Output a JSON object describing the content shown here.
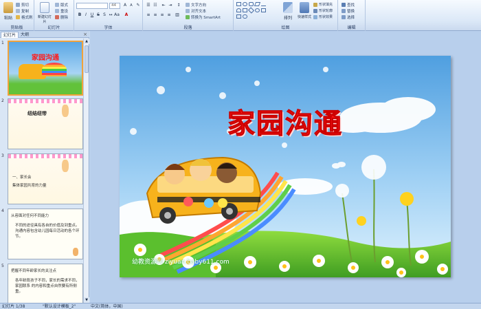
{
  "ribbon": {
    "groups": {
      "clipboard": "剪贴板",
      "slides": "幻灯片",
      "font": "字体",
      "paragraph": "段落",
      "drawing": "绘图",
      "editing": "编辑"
    },
    "paste": "粘贴",
    "cut": "剪切",
    "copy": "复制",
    "format_painter": "格式刷",
    "new_slide": "新建幻灯片",
    "layout": "版式",
    "reset": "重设",
    "delete": "删除",
    "font_size": "44",
    "text_direction": "文字方向",
    "align_text": "对齐文本",
    "smartart": "转换为 SmartArt",
    "arrange": "排列",
    "quick_styles": "快速样式",
    "shape_fill": "形状填充",
    "shape_outline": "形状轮廓",
    "shape_effects": "形状效果",
    "find": "查找",
    "replace": "替换",
    "select": "选择"
  },
  "panel": {
    "tab_slides": "幻灯片",
    "tab_outline": "大纲",
    "close": "×"
  },
  "thumbnails": [
    {
      "num": "1",
      "title": "家园沟通"
    },
    {
      "num": "2",
      "title": "纽结纽带"
    },
    {
      "num": "3",
      "lines": [
        "一、家长会",
        "集体家园共育的力量"
      ]
    },
    {
      "num": "4",
      "lines": [
        "从容面对任何不同能力",
        "不同的途径具有各自的价值及到重点。沟通内容包含幼儿园每日活动的各个环节。"
      ]
    },
    {
      "num": "5",
      "lines": [
        "把握不同年龄家长的关注点",
        "各年龄段孩子不同，家长的需求不同，家园联系 的内容和重点自然要有所侧重。"
      ]
    }
  ],
  "slide": {
    "title": "家园沟通",
    "watermark": "幼教资源网 ziyuan.baby611.com"
  },
  "status": {
    "slide_count": "幻灯片 1/38",
    "theme": "\"默认设计模板_2\"",
    "language": "中文(简体，中国)"
  },
  "colors": {
    "title_red": "#ff1a1a",
    "sky_top": "#4f9fe0",
    "grass": "#5bbf2e",
    "selection": "#f2a23a"
  }
}
